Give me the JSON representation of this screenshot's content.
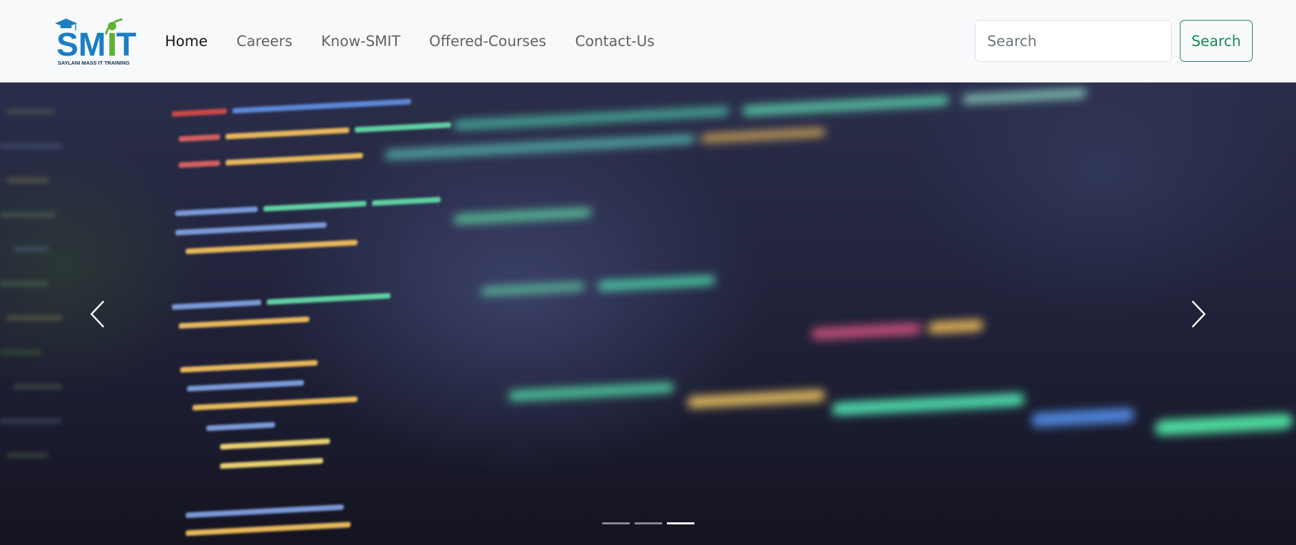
{
  "brand": {
    "logo_text": "SMIT",
    "logo_subtext": "SAYLANI MASS IT TRAINING",
    "colors": {
      "blue": "#1b7fc4",
      "green": "#5fb136",
      "navy": "#0b2f5a"
    }
  },
  "nav": {
    "items": [
      {
        "label": "Home",
        "active": true
      },
      {
        "label": "Careers",
        "active": false
      },
      {
        "label": "Know-SMIT",
        "active": false
      },
      {
        "label": "Offered-Courses",
        "active": false
      },
      {
        "label": "Contact-Us",
        "active": false
      }
    ]
  },
  "search": {
    "placeholder": "Search",
    "button_label": "Search",
    "accent_color": "#198754"
  },
  "carousel": {
    "slide_count": 3,
    "active_index": 2,
    "prev_icon": "chevron-left-icon",
    "next_icon": "chevron-right-icon",
    "image_description_icon": "code-screen-image"
  }
}
